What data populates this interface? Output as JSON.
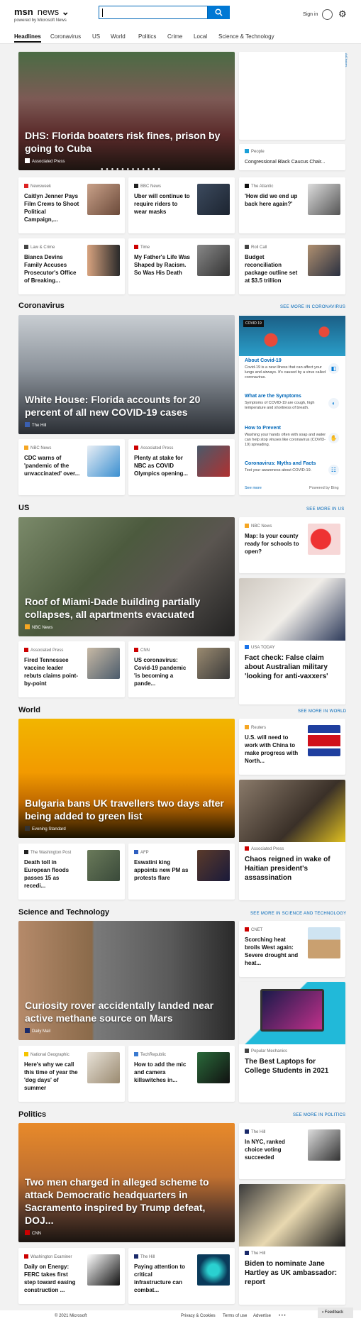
{
  "header": {
    "logo": "msn",
    "product": "news",
    "powered": "powered by Microsoft News",
    "search_value": "",
    "signin": "Sign in"
  },
  "nav": [
    "Headlines",
    "Coronavirus",
    "US",
    "World",
    "Politics",
    "Crime",
    "Local",
    "Science & Technology"
  ],
  "top": {
    "hero": {
      "title": "DHS: Florida boaters risk fines, prison by going to Cuba",
      "source": "Associated Press"
    },
    "people_card": {
      "source": "People",
      "title": "Congressional Black Caucus Chair..."
    },
    "ad_choices": "AdChoices",
    "cards": [
      {
        "source": "Newsweek",
        "title": "Caitlyn Jenner Pays Film Crews to Shoot Political Campaign,..."
      },
      {
        "source": "BBC News",
        "title": "Uber will continue to require riders to wear masks"
      },
      {
        "source": "The Atlantic",
        "title": "'How did we end up back here again?'"
      },
      {
        "source": "Law & Crime",
        "title": "Bianca Devins Family Accuses Prosecutor's Office of Breaking..."
      },
      {
        "source": "Time",
        "title": "My Father's Life Was Shaped by Racism. So Was His Death"
      },
      {
        "source": "Roll Call",
        "title": "Budget reconciliation package outline set at $3.5 trillion"
      }
    ]
  },
  "coronavirus": {
    "label": "Coronavirus",
    "more": "SEE MORE IN CORONAVIRUS",
    "hero": {
      "title": "White House: Florida accounts for 20 percent of all new COVID-19 cases",
      "source": "The Hill"
    },
    "cards": [
      {
        "source": "NBC News",
        "title": "CDC warns of 'pandemic of the unvaccinated' over..."
      },
      {
        "source": "Associated Press",
        "title": "Plenty at stake for NBC as COVID Olympics opening..."
      }
    ],
    "widget": {
      "tag": "COVID 19",
      "items": [
        {
          "h": "About Covid-19",
          "d": "Covid-19 is a new illness that can affect your lungs and airways. It's caused by a virus called coronavirus."
        },
        {
          "h": "What are the Symptoms",
          "d": "Symptoms of COVID-19 are cough, high temperature and shortness of breath."
        },
        {
          "h": "How to Prevent",
          "d": "Washing your hands often with soap and water can help stop viruses like coronavirus (COVID-19) spreading."
        },
        {
          "h": "Coronavirus: Myths and Facts",
          "d": "Test your awareness about COVID-19."
        }
      ],
      "see_more": "See more",
      "powered": "Powered by Bing"
    }
  },
  "us": {
    "label": "US",
    "more": "SEE MORE IN US",
    "hero": {
      "title": "Roof of Miami-Dade building partially collapses, all apartments evacuated",
      "source": "NBC News"
    },
    "side1": {
      "source": "NBC News",
      "title": "Map: Is your county ready for schools to open?"
    },
    "side2": {
      "source": "USA TODAY",
      "title": "Fact check: False claim about Australian military 'looking for anti-vaxxers'"
    },
    "cards": [
      {
        "source": "Associated Press",
        "title": "Fired Tennessee vaccine leader rebuts claims point-by-point"
      },
      {
        "source": "CNN",
        "title": "US coronavirus: Covid-19 pandemic 'is becoming a pande..."
      }
    ]
  },
  "world": {
    "label": "World",
    "more": "SEE MORE IN WORLD",
    "hero": {
      "title": "Bulgaria bans UK travellers two days after being added to green list",
      "source": "Evening Standard"
    },
    "side1": {
      "source": "Reuters",
      "title": "U.S. will need to work with China to make progress with North..."
    },
    "side2": {
      "source": "Associated Press",
      "title": "Chaos reigned in wake of Haitian president's assassination"
    },
    "cards": [
      {
        "source": "The Washington Post",
        "title": "Death toll in European floods passes 15 as recedi..."
      },
      {
        "source": "AFP",
        "title": "Eswatini king appoints new PM as protests flare"
      }
    ]
  },
  "science": {
    "label": "Science and Technology",
    "more": "SEE MORE IN SCIENCE AND TECHNOLOGY",
    "hero": {
      "title": "Curiosity rover accidentally landed near active methane source on Mars",
      "source": "Daily Mail"
    },
    "side1": {
      "source": "CNET",
      "title": "Scorching heat broils West again: Severe drought and heat..."
    },
    "side2": {
      "source": "Popular Mechanics",
      "title": "The Best Laptops for College Students in 2021"
    },
    "cards": [
      {
        "source": "National Geographic",
        "title": "Here's why we call this time of year the 'dog days' of summer"
      },
      {
        "source": "TechRepublic",
        "title": "How to add the mic and camera killswitches in..."
      }
    ]
  },
  "politics": {
    "label": "Politics",
    "more": "SEE MORE IN POLITICS",
    "hero": {
      "title": "Two men charged in alleged scheme to attack Democratic headquarters in Sacramento inspired by Trump defeat, DOJ...",
      "source": "CNN"
    },
    "side1": {
      "source": "The Hill",
      "title": "In NYC, ranked choice voting succeeded"
    },
    "side2": {
      "source": "The Hill",
      "title": "Biden to nominate Jane Hartley as UK ambassador: report"
    },
    "cards": [
      {
        "source": "Washington Examiner",
        "title": "Daily on Energy: FERC takes first step toward easing construction ..."
      },
      {
        "source": "The Hill",
        "title": "Paying attention to critical infrastructure can combat..."
      }
    ]
  },
  "footer": {
    "copyright": "© 2021 Microsoft",
    "privacy": "Privacy & Cookies",
    "terms": "Terms of use",
    "advertise": "Advertise",
    "feedback": "Feedback"
  }
}
